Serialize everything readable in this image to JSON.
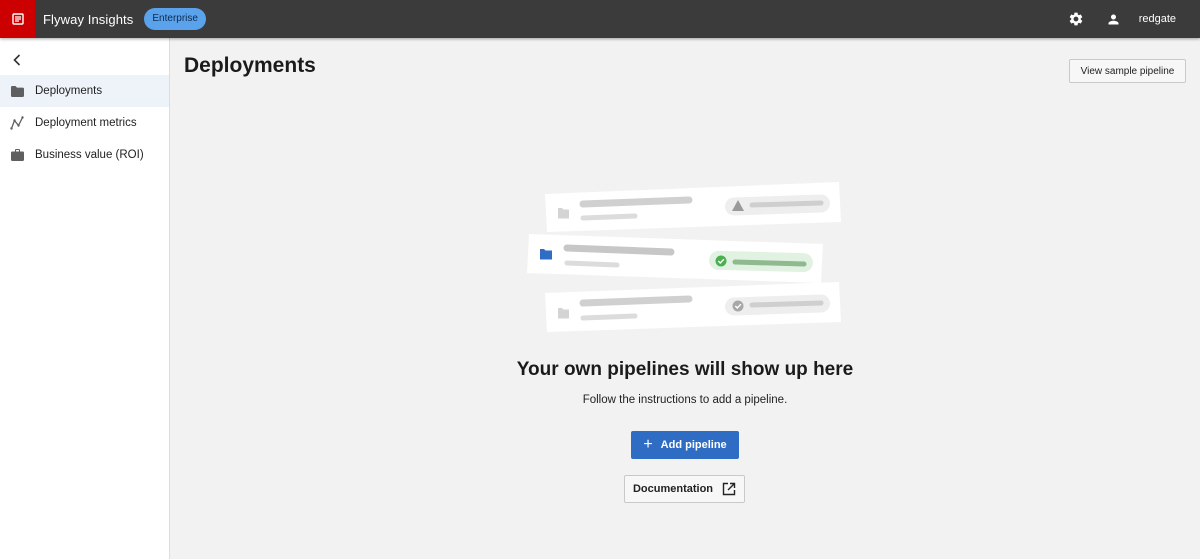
{
  "topbar": {
    "app_title": "Flyway Insights",
    "badge": "Enterprise",
    "brand": "redgate",
    "icons": [
      "flyway-logo-icon",
      "gear-icon",
      "user-icon"
    ],
    "colors": {
      "bar": "#3b3b3b",
      "logo": "#cc0000",
      "badge": "#5aa2ec"
    }
  },
  "sidebar": {
    "collapse_icon": "chevron-left-icon",
    "items": [
      {
        "label": "Deployments",
        "icon": "folder-icon",
        "active": true
      },
      {
        "label": "Deployment metrics",
        "icon": "line-chart-icon",
        "active": false
      },
      {
        "label": "Business value (ROI)",
        "icon": "briefcase-icon",
        "active": false
      }
    ]
  },
  "main": {
    "title": "Deployments",
    "sample_button": "View sample pipeline",
    "empty_state": {
      "heading": "Your own pipelines will show up here",
      "subtext": "Follow the instructions to add a pipeline.",
      "add_button": "Add pipeline",
      "docs_button": "Documentation"
    },
    "colors": {
      "primary": "#2f6dc4",
      "success": "#4caf50"
    }
  }
}
